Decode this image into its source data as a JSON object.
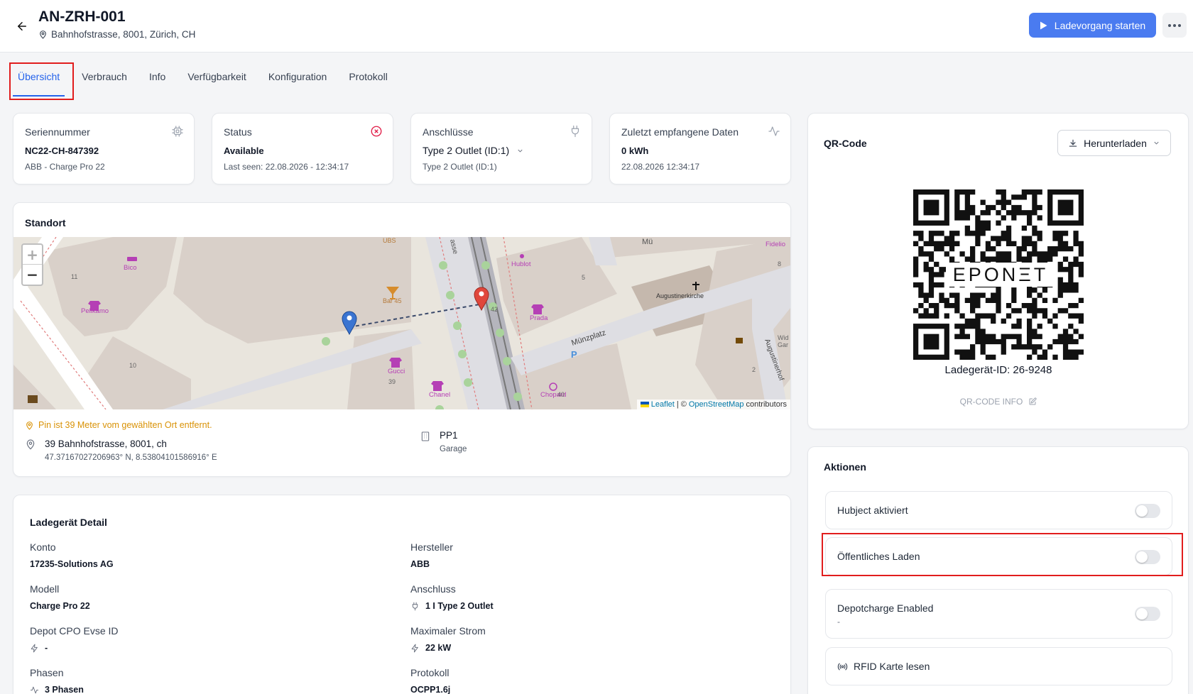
{
  "header": {
    "title": "AN-ZRH-001",
    "address": "Bahnhofstrasse, 8001, Zürich, CH",
    "start_button": "Ladevorgang starten"
  },
  "tabs": [
    {
      "label": "Übersicht",
      "active": true
    },
    {
      "label": "Verbrauch"
    },
    {
      "label": "Info"
    },
    {
      "label": "Verfügbarkeit"
    },
    {
      "label": "Konfiguration"
    },
    {
      "label": "Protokoll"
    }
  ],
  "stats": {
    "serial": {
      "label": "Seriennummer",
      "value": "NC22-CH-847392",
      "sub": "ABB - Charge Pro 22",
      "icon": "chip-icon"
    },
    "status": {
      "label": "Status",
      "value": "Available",
      "sub": "Last seen: 22.08.2026 - 12:34:17",
      "icon": "x-circle-icon",
      "icon_color": "#e11d48"
    },
    "connectors": {
      "label": "Anschlüsse",
      "selected": "Type 2 Outlet (ID:1)",
      "sub": "Type 2 Outlet (ID:1)",
      "icon": "plug-icon"
    },
    "last_data": {
      "label": "Zuletzt empfangene Daten",
      "value": "0 kWh",
      "sub": "22.08.2026 12:34:17",
      "icon": "activity-icon"
    }
  },
  "location": {
    "title": "Standort",
    "warning": "Pin ist 39 Meter vom gewählten Ort entfernt.",
    "address": "39 Bahnhofstrasse, 8001, ch",
    "coordinates": "47.37167027206963° N, 8.53804101586916° E",
    "parking_name": "PP1",
    "parking_type": "Garage",
    "map": {
      "zoom_in": "+",
      "zoom_out": "−",
      "attribution_leaflet": "Leaflet",
      "attribution_sep": "| ©",
      "attribution_osm": "OpenStreetMap",
      "attribution_suffix": "contributors",
      "labels": {
        "ubs": "UBS",
        "strasse": "asse",
        "hublot": "Hublot",
        "mu": "Mü",
        "fidelio": "Fidelio",
        "n8": "8",
        "bico": "Bico",
        "n11": "11",
        "pelikamo": "Pelikamo",
        "bar45": "Bar 45",
        "n42": "42",
        "prada": "Prada",
        "augustinerkirche": "Augustinerkirche",
        "n5": "5",
        "muenzplatz": "Münzplatz",
        "wid": "Wid",
        "gar": "Gar",
        "augustinerhof": "Augustinerhof",
        "n10": "10",
        "gucci": "Gucci",
        "n39": "39",
        "chanel": "Chanel",
        "chopard": "Chopard",
        "n40": "40",
        "n2": "2"
      }
    }
  },
  "detail": {
    "title": "Ladegerät Detail",
    "konto": {
      "label": "Konto",
      "value": "17235-Solutions AG"
    },
    "hersteller": {
      "label": "Hersteller",
      "value": "ABB"
    },
    "modell": {
      "label": "Modell",
      "value": "Charge Pro 22"
    },
    "anschluss": {
      "label": "Anschluss",
      "value": "1 I Type 2 Outlet"
    },
    "evse": {
      "label": "Depot CPO Evse ID",
      "value": "-"
    },
    "strom": {
      "label": "Maximaler Strom",
      "value": "22 kW"
    },
    "phasen": {
      "label": "Phasen",
      "value": "3 Phasen"
    },
    "protokoll": {
      "label": "Protokoll",
      "value": "OCPP1.6j"
    }
  },
  "qr": {
    "title": "QR-Code",
    "download": "Herunterladen",
    "logo_text": "EPONΞT",
    "charger_id": "Ladegerät-ID: 26-9248",
    "info": "QR-CODE INFO"
  },
  "actions": {
    "title": "Aktionen",
    "hubject": {
      "label": "Hubject aktiviert",
      "enabled": false
    },
    "public": {
      "label": "Öffentliches Laden",
      "enabled": false
    },
    "depot": {
      "label": "Depotcharge Enabled",
      "sub": "-",
      "enabled": false
    },
    "rfid": {
      "label": "RFID Karte lesen"
    }
  }
}
